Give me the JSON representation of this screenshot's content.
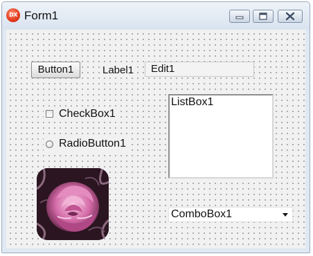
{
  "window": {
    "title": "Form1",
    "icon": "delphi-app-icon",
    "icon_text": "DX",
    "caption_buttons": [
      "minimize-icon",
      "maximize-icon",
      "close-icon"
    ]
  },
  "form": {
    "button": {
      "label": "Button1"
    },
    "label": {
      "text": "Label1"
    },
    "edit": {
      "value": "Edit1"
    },
    "checkbox": {
      "label": "CheckBox1",
      "checked": false
    },
    "radio": {
      "label": "RadioButton1",
      "selected": false
    },
    "listbox": {
      "items": [
        "ListBox1"
      ]
    },
    "image": {
      "subject": "pink-rose"
    },
    "combobox": {
      "value": "ComboBox1"
    }
  },
  "colors": {
    "title_bar": "#dfe8f3",
    "client_area": "#f1f1f1",
    "grid_dots": "#9a9a9a",
    "app_icon": "#e23a1e"
  }
}
